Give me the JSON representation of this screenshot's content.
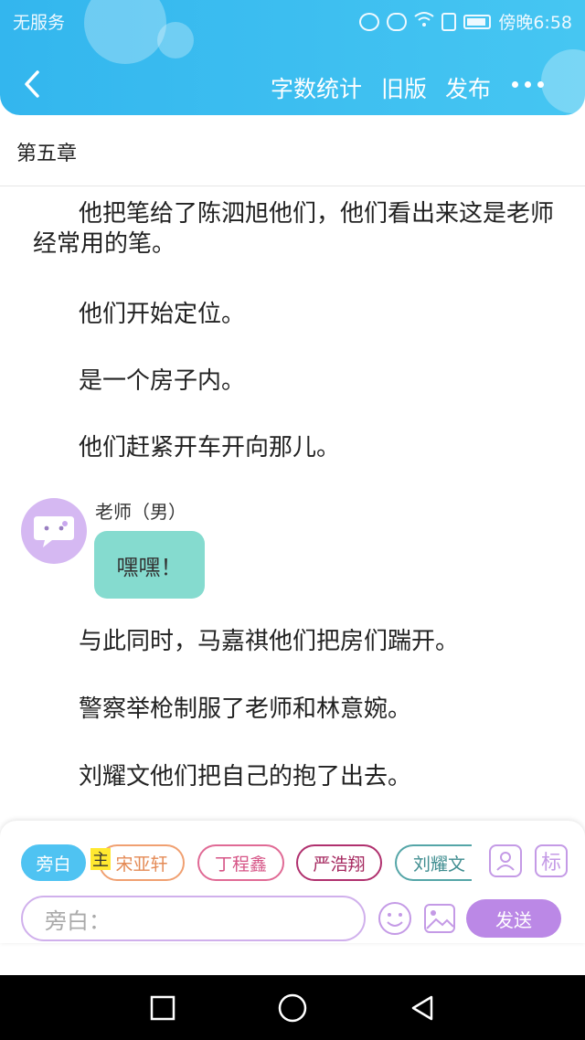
{
  "status": {
    "carrier": "无服务",
    "time": "傍晚6:58"
  },
  "navbar": {
    "word_count_label": "字数统计",
    "old_version_label": "旧版",
    "publish_label": "发布"
  },
  "chapter": {
    "title": "第五章"
  },
  "paragraphs": [
    "他把笔给了陈泗旭他们，他们看出来这是老师经常用的笔。",
    "他们开始定位。",
    "是一个房子内。",
    "他们赶紧开车开向那儿。",
    "与此同时，马嘉祺他们把房们踹开。",
    "警察举枪制服了老师和林意婉。",
    "刘耀文他们把自己的抱了出去。"
  ],
  "chat": {
    "speaker": "老师（男）",
    "message": "嘿嘿！"
  },
  "composer": {
    "role_chips": [
      "旁白",
      "宋亚轩",
      "丁程鑫",
      "严浩翔",
      "刘耀文"
    ],
    "main_tag": "主",
    "mark_icon_label": "标",
    "input_placeholder": "旁白：",
    "send_label": "发送"
  },
  "colors": {
    "header": "#33b6ee",
    "accent_purple": "#bb88e6",
    "chat_bubble": "#85dbcf"
  }
}
